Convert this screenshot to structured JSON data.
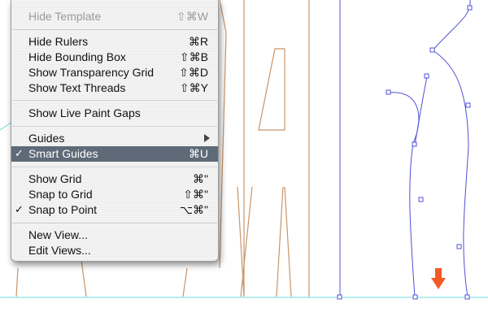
{
  "menu": {
    "items": [
      {
        "label": "Hide Template",
        "shortcut": "⇧⌘W",
        "disabled": true
      },
      {
        "label": "Hide Rulers",
        "shortcut": "⌘R"
      },
      {
        "label": "Hide Bounding Box",
        "shortcut": "⇧⌘B"
      },
      {
        "label": "Show Transparency Grid",
        "shortcut": "⇧⌘D"
      },
      {
        "label": "Show Text Threads",
        "shortcut": "⇧⌘Y"
      },
      {
        "label": "Show Live Paint Gaps",
        "shortcut": ""
      },
      {
        "label": "Guides",
        "shortcut": "",
        "submenu": true
      },
      {
        "label": "Smart Guides",
        "shortcut": "⌘U",
        "checked": true,
        "selected": true,
        "check": "✓"
      },
      {
        "label": "Show Grid",
        "shortcut": "⌘\""
      },
      {
        "label": "Snap to Grid",
        "shortcut": "⇧⌘\""
      },
      {
        "label": "Snap to Point",
        "shortcut": "⌥⌘\"",
        "checked": true,
        "check": "✓"
      },
      {
        "label": "New View...",
        "shortcut": ""
      },
      {
        "label": "Edit Views...",
        "shortcut": ""
      }
    ]
  },
  "colors": {
    "selection": "#5e6a78",
    "outline_tan": "#c8956a",
    "path_blue": "#5050d8",
    "guide_cyan": "#6ed8e0",
    "arrow_orange": "#f25a25"
  },
  "icons": {
    "checkmark": "checkmark-icon",
    "submenu": "submenu-arrow-icon",
    "down_arrow": "down-arrow-icon"
  }
}
